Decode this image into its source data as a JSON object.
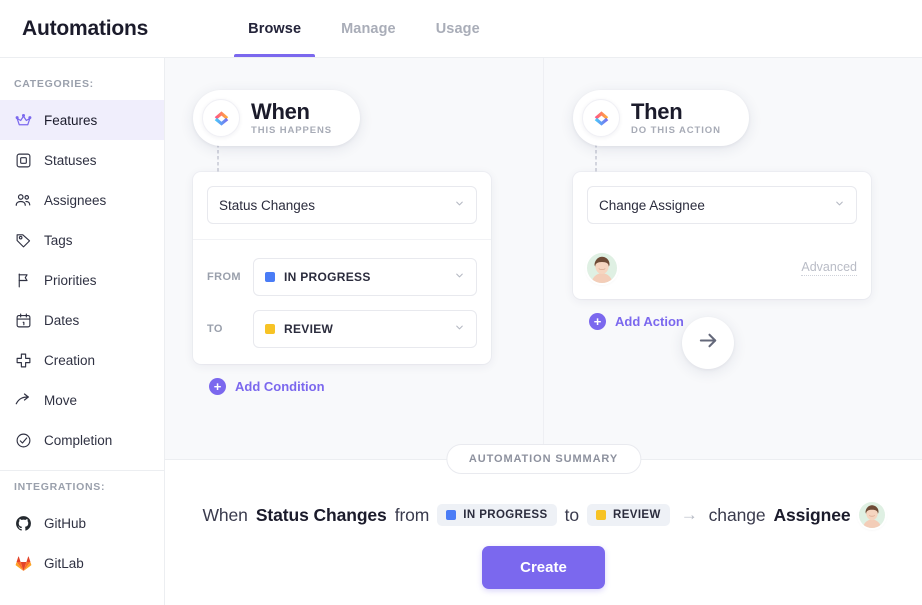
{
  "header": {
    "title": "Automations",
    "tabs": [
      {
        "label": "Browse",
        "active": true
      },
      {
        "label": "Manage",
        "active": false
      },
      {
        "label": "Usage",
        "active": false
      }
    ]
  },
  "sidebar": {
    "categories_label": "CATEGORIES:",
    "integrations_label": "INTEGRATIONS:",
    "categories": [
      {
        "label": "Features",
        "icon": "crown-icon",
        "active": true
      },
      {
        "label": "Statuses",
        "icon": "square-outline-icon",
        "active": false
      },
      {
        "label": "Assignees",
        "icon": "people-icon",
        "active": false
      },
      {
        "label": "Tags",
        "icon": "tag-icon",
        "active": false
      },
      {
        "label": "Priorities",
        "icon": "flag-icon",
        "active": false
      },
      {
        "label": "Dates",
        "icon": "calendar-icon",
        "active": false
      },
      {
        "label": "Creation",
        "icon": "plus-icon",
        "active": false
      },
      {
        "label": "Move",
        "icon": "arrow-move-icon",
        "active": false
      },
      {
        "label": "Completion",
        "icon": "check-circle-icon",
        "active": false
      }
    ],
    "integrations": [
      {
        "label": "GitHub",
        "icon": "github-icon"
      },
      {
        "label": "GitLab",
        "icon": "gitlab-icon"
      }
    ]
  },
  "builder": {
    "when": {
      "title": "When",
      "subtitle": "THIS HAPPENS",
      "logo": "clickup-logo-icon",
      "trigger": "Status Changes",
      "from_label": "FROM",
      "from_value": "IN PROGRESS",
      "from_color": "#4a7cf6",
      "to_label": "TO",
      "to_value": "REVIEW",
      "to_color": "#f7c325",
      "add_condition": "Add Condition"
    },
    "then": {
      "title": "Then",
      "subtitle": "DO THIS ACTION",
      "logo": "clickup-logo-icon",
      "action": "Change Assignee",
      "advanced": "Advanced",
      "add_action": "Add Action"
    },
    "flow_arrow": "arrow-right-icon"
  },
  "summary": {
    "chip": "AUTOMATION SUMMARY",
    "prefix": "When",
    "trigger": "Status Changes",
    "from_word": "from",
    "from_value": "IN PROGRESS",
    "from_color": "#4a7cf6",
    "to_word": "to",
    "to_value": "REVIEW",
    "to_color": "#f7c325",
    "arrow": "→",
    "action_word": "change",
    "action_target": "Assignee",
    "create_button": "Create"
  },
  "colors": {
    "accent": "#7b68ee",
    "active_nav_bg": "#f0eefc",
    "canvas_bg": "#f8f9fb",
    "badge_bg": "#eef1f6"
  }
}
